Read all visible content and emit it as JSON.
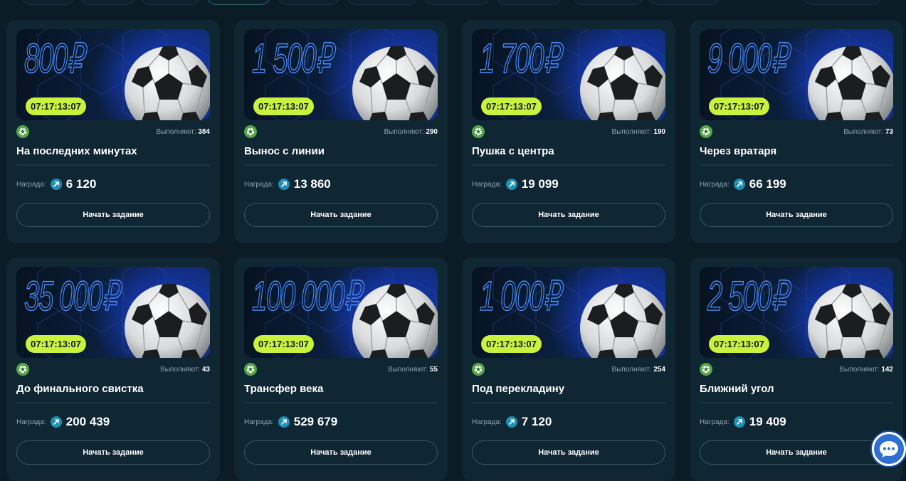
{
  "tasks": [
    {
      "amount": "800₽",
      "timer": "07:17:13:07",
      "performers_label": "Выполняют:",
      "performers": "384",
      "title": "На последних минутах",
      "reward_label": "Награда:",
      "reward": "6 120",
      "button": "Начать задание"
    },
    {
      "amount": "1 500₽",
      "timer": "07:17:13:07",
      "performers_label": "Выполняют:",
      "performers": "290",
      "title": "Вынос с линии",
      "reward_label": "Награда:",
      "reward": "13 860",
      "button": "Начать задание"
    },
    {
      "amount": "1 700₽",
      "timer": "07:17:13:07",
      "performers_label": "Выполняют:",
      "performers": "190",
      "title": "Пушка с центра",
      "reward_label": "Награда:",
      "reward": "19 099",
      "button": "Начать задание"
    },
    {
      "amount": "9 000₽",
      "timer": "07:17:13:07",
      "performers_label": "Выполняют:",
      "performers": "73",
      "title": "Через вратаря",
      "reward_label": "Награда:",
      "reward": "66 199",
      "button": "Начать задание"
    },
    {
      "amount": "35 000₽",
      "timer": "07:17:13:07",
      "performers_label": "Выполняют:",
      "performers": "43",
      "title": "До финального свистка",
      "reward_label": "Награда:",
      "reward": "200 439",
      "button": "Начать задание"
    },
    {
      "amount": "100 000₽",
      "timer": "07:17:13:07",
      "performers_label": "Выполняют:",
      "performers": "55",
      "title": "Трансфер века",
      "reward_label": "Награда:",
      "reward": "529 679",
      "button": "Начать задание"
    },
    {
      "amount": "1 000₽",
      "timer": "07:17:13:07",
      "performers_label": "Выполняют:",
      "performers": "254",
      "title": "Под перекладину",
      "reward_label": "Награда:",
      "reward": "7 120",
      "button": "Начать задание"
    },
    {
      "amount": "2 500₽",
      "timer": "07:17:13:07",
      "performers_label": "Выполняют:",
      "performers": "142",
      "title": "Ближний угол",
      "reward_label": "Награда:",
      "reward": "19 409",
      "button": "Начать задание"
    }
  ],
  "icons": {
    "sport": "soccer-ball-icon",
    "reward": "arrow-coin-icon",
    "chat": "chat-bubble-icon"
  },
  "colors": {
    "timer_bg": "#c9f23e",
    "amount_outline": "#4a8dff",
    "card_bg": "#0f2633",
    "sport_icon": "#53a845",
    "coin": "#1f8fb5",
    "chat": "#2f6fd1"
  }
}
